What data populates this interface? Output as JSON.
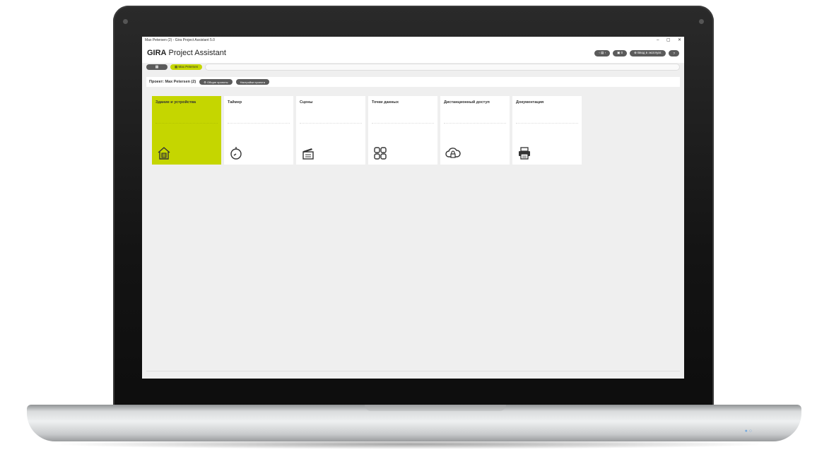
{
  "window": {
    "title": "Max Petersen (2) - Gira Project Assistant 5.0",
    "controls": [
      "–",
      "▢",
      "✕"
    ]
  },
  "app": {
    "brand_bold": "GIRA",
    "brand_rest": " Project Assistant"
  },
  "toolbar": {
    "buttons": [
      {
        "label": "‹ ▤ ›",
        "icon": "nav-icon"
      },
      {
        "label": "▣ 0",
        "icon": "device-icon"
      },
      {
        "label": "⊕ Ввод в эксплуат.",
        "icon": "commission-icon"
      },
      {
        "label": "?",
        "icon": "help-icon"
      }
    ]
  },
  "breadcrumb": {
    "home_label": "▦",
    "active_label": "▦ Max Petersen"
  },
  "project": {
    "title": "Проект: Max Petersen (2)",
    "buttons": [
      "⚙ Общие проекты",
      "Настройки проекта"
    ]
  },
  "tiles": [
    {
      "label": "Здание и устройства",
      "icon": "building-icon",
      "active": true
    },
    {
      "label": "Таймер",
      "icon": "timer-icon",
      "active": false
    },
    {
      "label": "Сцены",
      "icon": "scene-clapper-icon",
      "active": false
    },
    {
      "label": "Точки данных",
      "icon": "datapoints-icon",
      "active": false
    },
    {
      "label": "Дистанционный доступ",
      "icon": "cloud-lock-icon",
      "active": false
    },
    {
      "label": "Документация",
      "icon": "printer-icon",
      "active": false
    }
  ],
  "colors": {
    "accent": "#c5d600",
    "dark_pill": "#5b5b5b",
    "screen_bg": "#efefef"
  }
}
